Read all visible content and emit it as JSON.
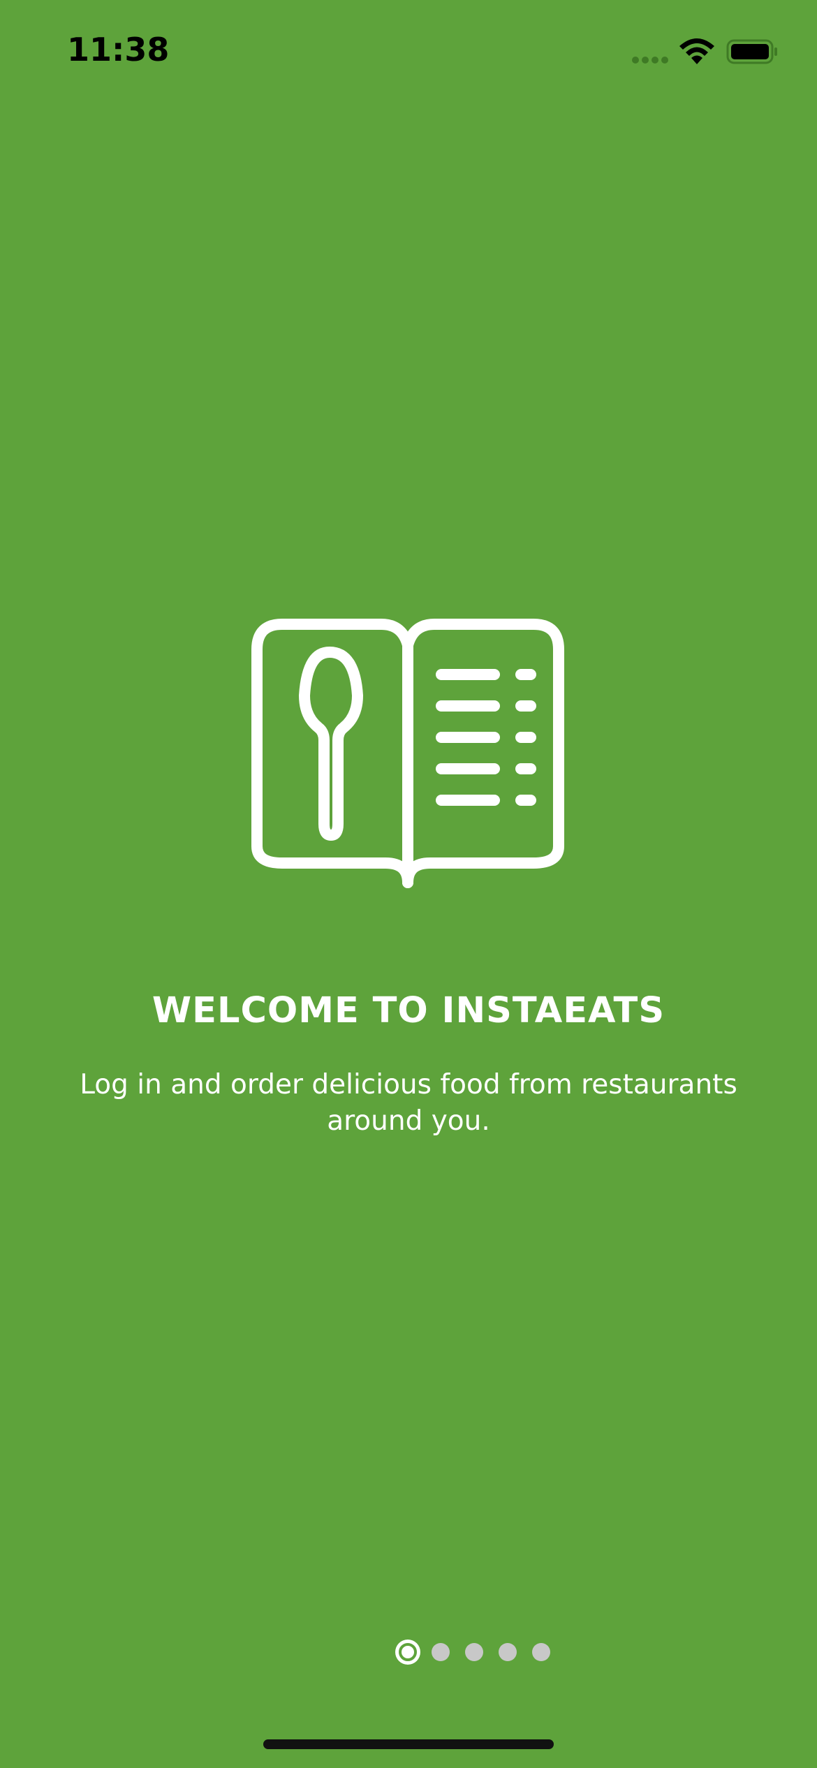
{
  "status_bar": {
    "time": "11:38",
    "signal_icon": "cellular-signal-icon",
    "wifi_icon": "wifi-icon",
    "battery_icon": "battery-icon"
  },
  "illustration": {
    "icon": "menu-book-with-spoon-icon"
  },
  "onboarding": {
    "title": "WELCOME TO INSTAEATS",
    "subtitle": "Log in and order delicious food from restaurants around you."
  },
  "pager": {
    "current_page": 1,
    "total_pages": 5
  },
  "colors": {
    "background": "#5ea33b",
    "text": "#ffffff",
    "dot_inactive": "#c8c8c8"
  }
}
